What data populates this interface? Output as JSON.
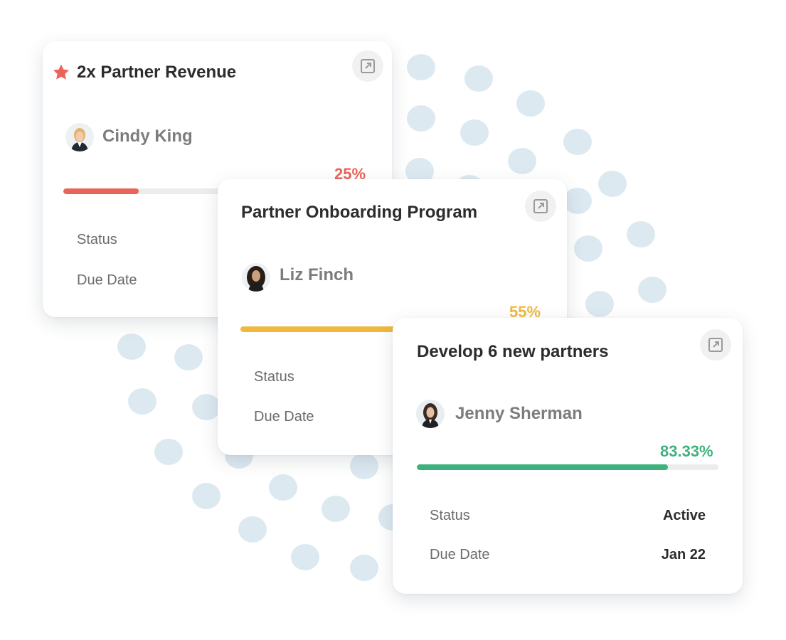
{
  "cards": [
    {
      "title": "2x Partner Revenue",
      "starred": true,
      "owner": "Cindy King",
      "progress_label": "25%",
      "progress": 0.25,
      "progress_color": "#eb6459",
      "status_label": "Status",
      "due_label": "Due Date"
    },
    {
      "title": "Partner Onboarding Program",
      "starred": false,
      "owner": "Liz Finch",
      "progress_label": "55%",
      "progress": 0.55,
      "progress_color": "#f0b93e",
      "status_label": "Status",
      "due_label": "Due Date"
    },
    {
      "title": "Develop 6 new partners",
      "starred": false,
      "owner": "Jenny Sherman",
      "progress_label": "83.33%",
      "progress": 0.8333,
      "progress_color": "#3db27d",
      "status_label": "Status",
      "status_value": "Active",
      "due_label": "Due Date",
      "due_value": "Jan 22"
    }
  ],
  "icons": {
    "star": "star-icon",
    "expand": "external-link-icon"
  },
  "colors": {
    "dots": "#dde9f1",
    "star": "#eb6459"
  }
}
